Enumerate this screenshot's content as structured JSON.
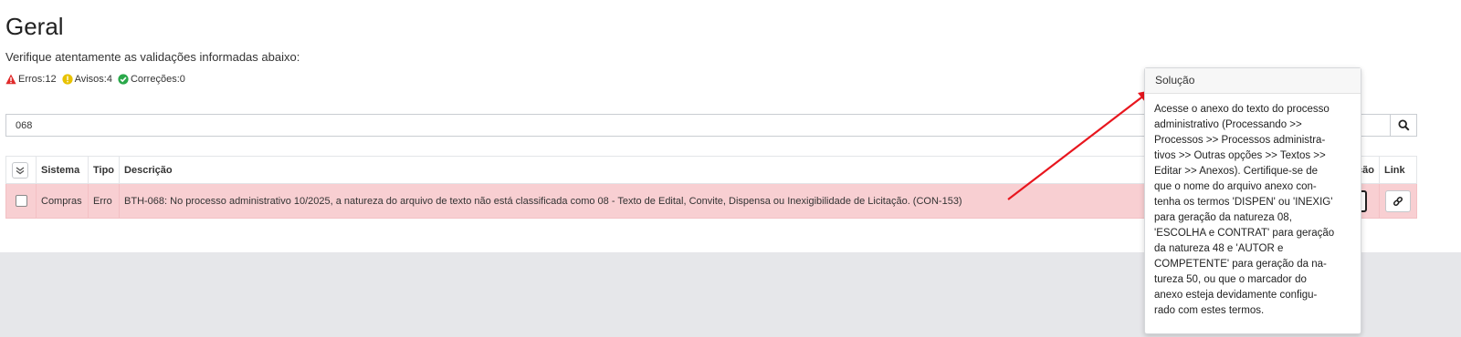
{
  "page": {
    "title": "Geral",
    "subtitle": "Verifique atentamente as validações informadas abaixo:"
  },
  "stats": {
    "errors": "Erros:12",
    "warnings": "Avisos:4",
    "corrections": "Correções:0",
    "error_color": "#e02b2b",
    "warning_color": "#e8c200",
    "correction_color": "#2aa84a"
  },
  "search": {
    "value": "068"
  },
  "table": {
    "headers": {
      "system": "Sistema",
      "type": "Tipo",
      "description": "Descrição",
      "solution": "Solução",
      "link": "Link"
    },
    "rows": [
      {
        "system": "Compras",
        "type": "Erro",
        "description": "BTH-068: No processo administrativo 10/2025, a natureza do arquivo de texto não está classificada como 08 - Texto de Edital, Convite, Dispensa ou Inexigibilidade de Licitação. (CON-153)",
        "solution_button": "?"
      }
    ]
  },
  "popover": {
    "title": "Solução",
    "lines": [
      "Acesse o anexo do texto do processo",
      "administrativo (Processando >>",
      "Processos >> Processos administra-",
      "tivos >> Outras opções >> Textos >>",
      "Editar >> Anexos). Certifique-se de",
      "que o nome do arquivo anexo con-",
      "tenha os termos 'DISPEN' ou 'INEXIG'",
      "para geração da natureza 08,",
      "'ESCOLHA e CONTRAT' para geração",
      "da natureza 48 e 'AUTOR e",
      "COMPETENTE' para geração da na-",
      "tureza 50, ou que o marcador do",
      "anexo esteja devidamente configu-",
      "rado com estes termos."
    ]
  },
  "icons": {
    "search": "search-icon",
    "select_all": "double-check-icon",
    "link": "link-icon"
  }
}
